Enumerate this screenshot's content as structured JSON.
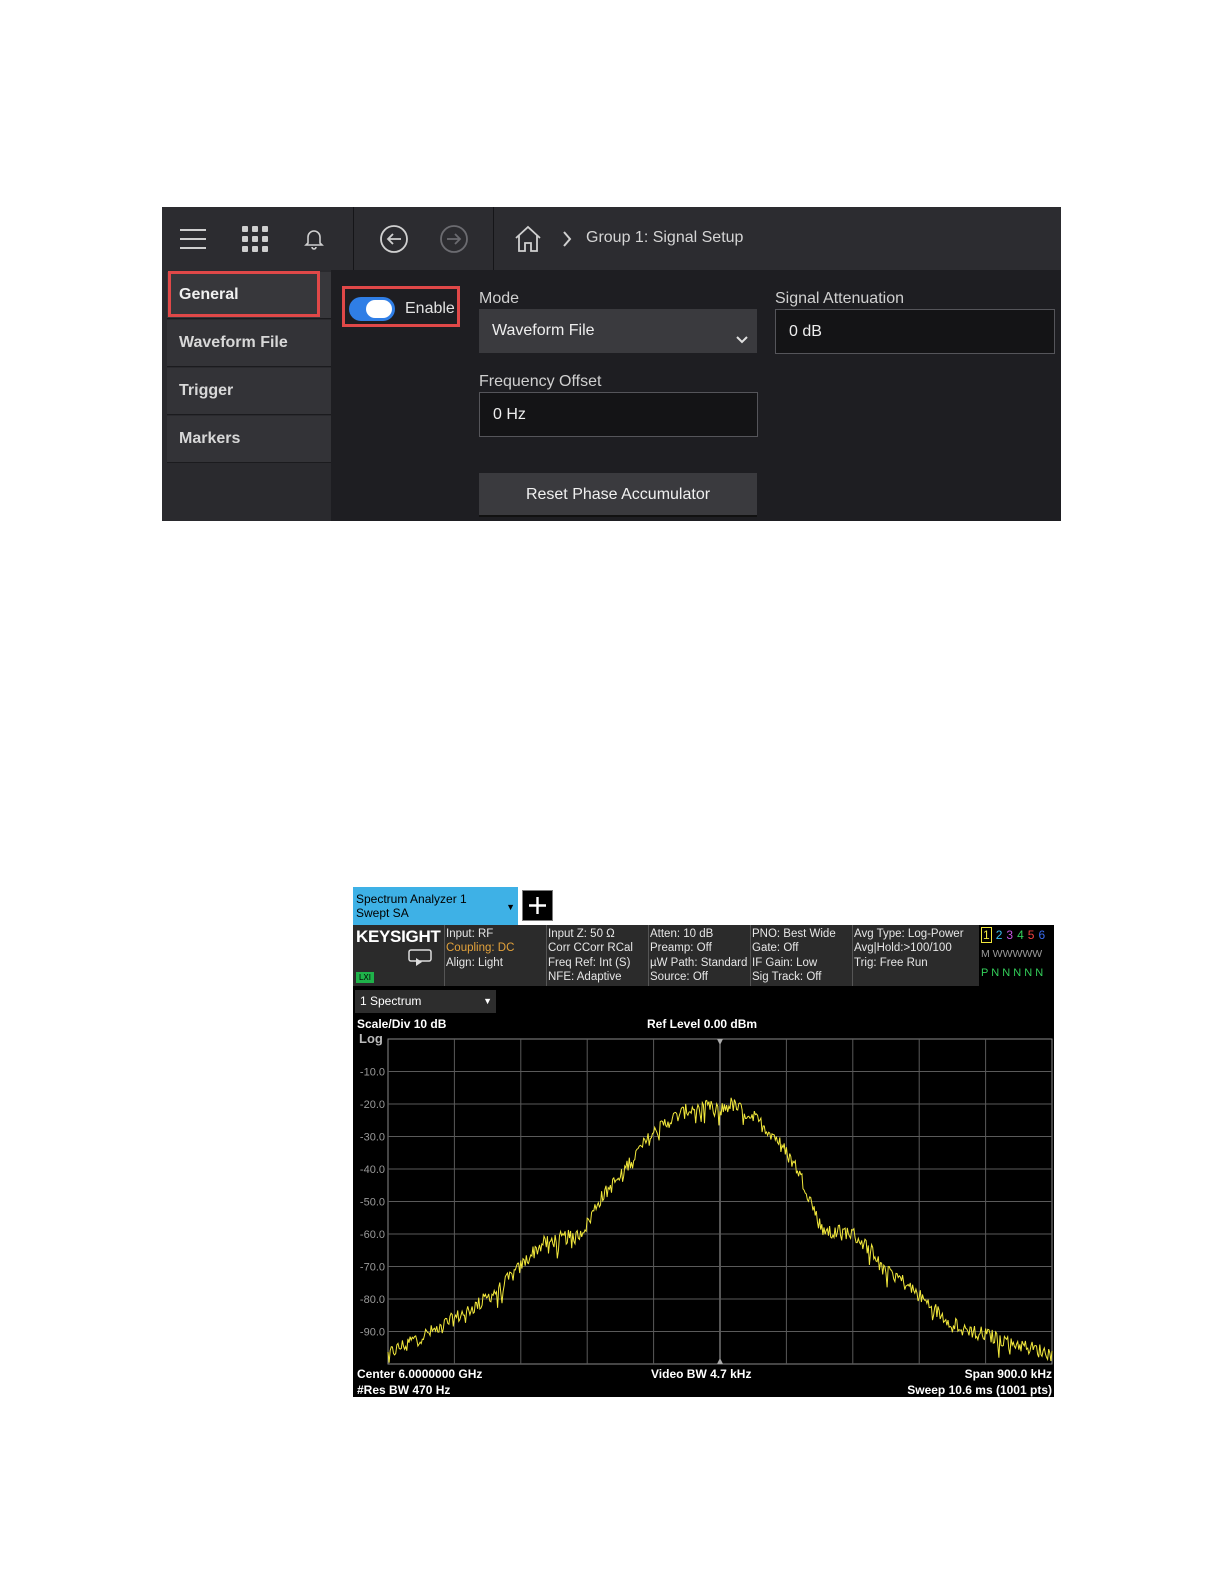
{
  "signal_setup": {
    "breadcrumb": "Group 1: Signal Setup",
    "topbar_icons": [
      "menu-icon",
      "apps-grid-icon",
      "bell-icon",
      "back-icon",
      "forward-icon",
      "home-icon",
      "chevron-right-icon"
    ],
    "sidebar": {
      "items": [
        {
          "label": "General",
          "active": true
        },
        {
          "label": "Waveform File"
        },
        {
          "label": "Trigger"
        },
        {
          "label": "Markers"
        }
      ]
    },
    "enable": {
      "label": "Enable",
      "on": true
    },
    "mode": {
      "label": "Mode",
      "value": "Waveform File"
    },
    "signal_attenuation": {
      "label": "Signal Attenuation",
      "value": "0 dB"
    },
    "frequency_offset": {
      "label": "Frequency Offset",
      "value": "0 Hz"
    },
    "reset_button": "Reset Phase Accumulator",
    "colors": {
      "background": "#1e1e22",
      "accent": "#2f7ee6",
      "highlight": "#e04848"
    }
  },
  "spectrum": {
    "tab": {
      "line1": "Spectrum Analyzer 1",
      "line2": "Swept SA"
    },
    "logo": "KEYSIGHT",
    "lxi_badge": "LXI",
    "info_cols": [
      [
        "Input: RF",
        "Coupling: DC",
        "Align: Light"
      ],
      [
        "Input Z: 50 Ω",
        "Corr CCorr RCal",
        "Freq Ref: Int (S)",
        "NFE: Adaptive"
      ],
      [
        "Atten: 10 dB",
        "Preamp: Off",
        "µW Path: Standard",
        "Source: Off"
      ],
      [
        "PNO: Best Wide",
        "Gate: Off",
        "IF Gain: Low",
        "Sig Track: Off"
      ],
      [
        "Avg Type: Log-Power",
        "Avg|Hold:>100/100",
        "Trig: Free Run"
      ]
    ],
    "trace_numbers": [
      "1",
      "2",
      "3",
      "4",
      "5",
      "6"
    ],
    "trace_colors": [
      "#f2e83c",
      "#3bbdf0",
      "#c755e0",
      "#33d05a",
      "#f04040",
      "#3a6cf0"
    ],
    "trace_m_row": "M WWWWW",
    "trace_p_row": "P N N N N N",
    "window_label": "1 Spectrum",
    "scale_div": "Scale/Div 10 dB",
    "log_label": "Log",
    "ref_level": "Ref Level 0.00 dBm",
    "center": "Center 6.0000000 GHz",
    "res_bw": "#Res BW 470 Hz",
    "video_bw": "Video BW 4.7 kHz",
    "span": "Span 900.0 kHz",
    "sweep": "Sweep 10.6 ms (1001 pts)"
  },
  "chart_data": {
    "type": "line",
    "ylim": [
      -100,
      0
    ],
    "y_ticks": [
      "-10.0",
      "-20.0",
      "-30.0",
      "-40.0",
      "-50.0",
      "-60.0",
      "-70.0",
      "-80.0",
      "-90.0"
    ],
    "grid": true,
    "x_divisions": 10,
    "xlim": [
      -450,
      450
    ],
    "x_unit": "kHz offset from center",
    "series": [
      {
        "color": "#f2e83c",
        "x": [
          -450,
          -420,
          -390,
          -360,
          -330,
          -300,
          -270,
          -255,
          -240,
          -225,
          -210,
          -195,
          -180,
          -165,
          -150,
          -135,
          -120,
          -105,
          -90,
          -75,
          -60,
          -45,
          -30,
          -15,
          0,
          15,
          30,
          45,
          60,
          75,
          90,
          105,
          120,
          135,
          150,
          165,
          180,
          195,
          210,
          225,
          240,
          255,
          270,
          300,
          330,
          360,
          390,
          420,
          450
        ],
        "y": [
          -97,
          -93,
          -90,
          -86,
          -82,
          -77,
          -70,
          -66,
          -63,
          -62,
          -61,
          -61,
          -57,
          -50,
          -46,
          -42,
          -37,
          -33,
          -29,
          -26,
          -24,
          -22,
          -21,
          -21,
          -22,
          -20,
          -22,
          -24,
          -27,
          -30,
          -35,
          -40,
          -48,
          -57,
          -60,
          -59,
          -60,
          -63,
          -66,
          -70,
          -73,
          -76,
          -79,
          -85,
          -89,
          -91,
          -93,
          -95,
          -97
        ]
      }
    ]
  }
}
